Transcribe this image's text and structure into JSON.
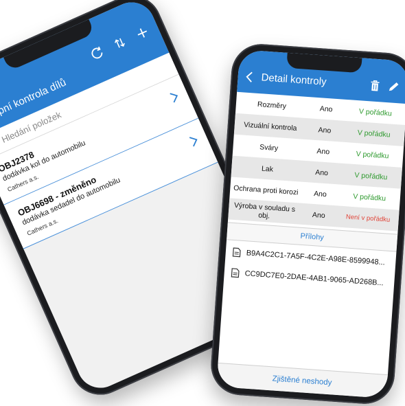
{
  "left_phone": {
    "header": {
      "title": "Vstupní kontrola dílů"
    },
    "icons": [
      "refresh-icon",
      "sort-icon",
      "add-icon"
    ],
    "search": {
      "placeholder": "Hledání položek",
      "value": ""
    },
    "items": [
      {
        "code": "OBJ2378",
        "description": "dodávka kol do automobilu",
        "company": "Cathers a.s."
      },
      {
        "code": "OBJ6698 - změněno",
        "description": "dodávka sedadel do automobilu",
        "company": "Cathers a.s."
      }
    ]
  },
  "right_phone": {
    "header": {
      "title": "Detail kontroly"
    },
    "checks": [
      {
        "name": "Rozměry",
        "answer": "Ano",
        "status": "V pořádku",
        "state": "ok"
      },
      {
        "name": "Vizuální kontrola",
        "answer": "Ano",
        "status": "V pořádku",
        "state": "ok"
      },
      {
        "name": "Sváry",
        "answer": "Ano",
        "status": "V pořádku",
        "state": "ok"
      },
      {
        "name": "Lak",
        "answer": "Ano",
        "status": "V pořádku",
        "state": "ok"
      },
      {
        "name": "Ochrana proti korozi",
        "answer": "Ano",
        "status": "V pořádku",
        "state": "ok"
      },
      {
        "name": "Výroba v souladu s obj.",
        "answer": "Ano",
        "status": "Není v pořádku",
        "state": "bad"
      }
    ],
    "attachments_header": "Přílohy",
    "attachments": [
      "B9A4C2C1-7A5F-4C2E-A98E-8599948...",
      "CC9DC7E0-2DAE-4AB1-9065-AD268B..."
    ],
    "bottom_tab": "Zjištěné neshody"
  },
  "colors": {
    "accent": "#2b7fd1",
    "ok": "#2f9a2f",
    "bad": "#e0453a"
  }
}
